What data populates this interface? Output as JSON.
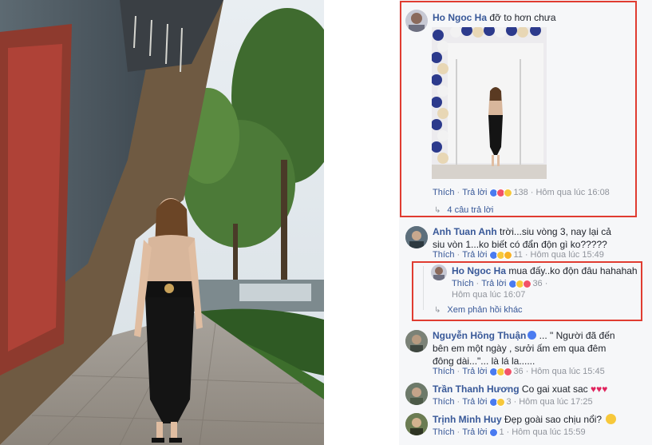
{
  "colors": {
    "link": "#385898",
    "muted": "#90949c",
    "highlight_border": "#e03c31"
  },
  "comments": [
    {
      "author": "Ho Ngoc Ha",
      "text": "đỡ to hơn chưa",
      "like": "Thích",
      "reply": "Trả lời",
      "reactions": [
        "like-reaction-icon",
        "love-reaction-icon",
        "haha-reaction-icon"
      ],
      "reaction_count": "138",
      "timestamp": "Hôm qua lúc 16:08",
      "replies_label": "4 câu trả lời"
    },
    {
      "author": "Anh Tuan Anh",
      "text": "trời...siu vòng 3, nay lại cả siu vòn 1...ko biết có đẩn độn gì ko?????",
      "like": "Thích",
      "reply": "Trả lời",
      "reactions": [
        "like-reaction-icon",
        "haha-reaction-icon",
        "wow-reaction-icon"
      ],
      "reaction_count": "11",
      "timestamp": "Hôm qua lúc 15:49"
    },
    {
      "author": "Ho Ngoc Ha",
      "text": "mua đấy..ko độn đâu hahahah",
      "like": "Thích",
      "reply": "Trả lời",
      "reactions": [
        "like-reaction-icon",
        "haha-reaction-icon",
        "love-reaction-icon"
      ],
      "reaction_count": "36",
      "timestamp": "Hôm qua lúc 16:07",
      "more_replies_label": "Xem phản hồi khác"
    },
    {
      "author": "Nguyễn Hồng Thuận",
      "text": "... \" Người đã đến bên em một ngày , sưởi ấm em qua đêm đông dài...\"... là lá la......",
      "like": "Thích",
      "reply": "Trả lời",
      "reactions": [
        "like-reaction-icon",
        "haha-reaction-icon",
        "love-reaction-icon"
      ],
      "reaction_count": "36",
      "timestamp": "Hôm qua lúc 15:45"
    },
    {
      "author": "Trần Thanh Hương",
      "text": "Co gai xuat sac",
      "like": "Thích",
      "reply": "Trả lời",
      "reactions": [
        "like-reaction-icon",
        "haha-reaction-icon"
      ],
      "reaction_count": "3",
      "timestamp": "Hôm qua lúc 17:25"
    },
    {
      "author": "Trịnh Minh Huy",
      "text": "Đẹp goài sao chịu nổi?",
      "like": "Thích",
      "reply": "Trả lời",
      "reactions": [
        "like-reaction-icon"
      ],
      "reaction_count": "1",
      "timestamp": "Hôm qua lúc 15:59"
    }
  ]
}
